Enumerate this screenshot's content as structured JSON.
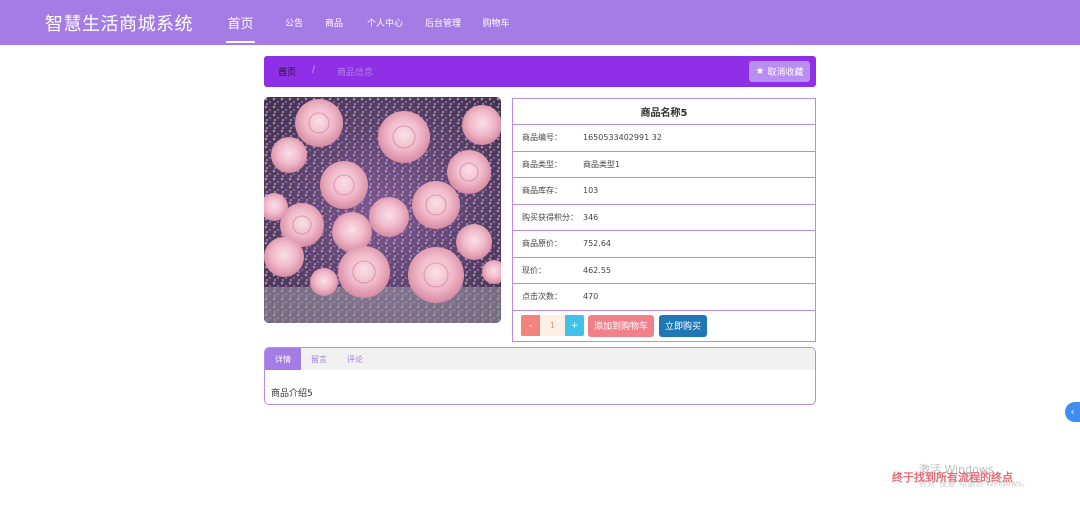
{
  "app": {
    "title": "智慧生活商城系统"
  },
  "nav": {
    "items": [
      {
        "label": "首页",
        "active": true
      },
      {
        "label": "公告",
        "active": false
      },
      {
        "label": "商品",
        "active": false
      },
      {
        "label": "个人中心",
        "active": false
      },
      {
        "label": "后台管理",
        "active": false
      },
      {
        "label": "购物车",
        "active": false
      }
    ]
  },
  "breadcrumb": {
    "home": "首页",
    "separator": "/",
    "current": "商品信息"
  },
  "favorite_button": {
    "label": "取消收藏",
    "icon": "star-icon"
  },
  "product": {
    "image_alt": "pink roses bouquet",
    "name": "商品名称5",
    "fields": [
      {
        "key": "商品编号：",
        "value": "1650533402991 32"
      },
      {
        "key": "商品类型：",
        "value": "商品类型1"
      },
      {
        "key": "商品库存：",
        "value": "103"
      },
      {
        "key": "购买获得积分：",
        "value": "346"
      },
      {
        "key": "商品原价：",
        "value": "752.64"
      },
      {
        "key": "现价：",
        "value": "462.55"
      },
      {
        "key": "点击次数：",
        "value": "470"
      }
    ]
  },
  "quantity": {
    "minus": "-",
    "value": "1",
    "plus": "+"
  },
  "actions": {
    "add_to_cart": "添加到购物车",
    "buy_now": "立即购买"
  },
  "tabs": {
    "items": [
      {
        "label": "详情",
        "active": true
      },
      {
        "label": "留言",
        "active": false
      },
      {
        "label": "评论",
        "active": false
      }
    ],
    "content": "商品介绍5"
  },
  "side_toggle": {
    "icon": "chevron-left-icon",
    "glyph": "‹"
  },
  "watermark": {
    "activate": "激活 Windows",
    "sub": "转到“设置”以激活 Windows。",
    "overlay": "终于找到所有流程的终点"
  },
  "colors": {
    "navbar": "#a57ce6",
    "breadcrumb_bar": "#8f2fe6",
    "cart_button": "#f1808b",
    "buy_button": "#1f77b3",
    "border": "#b48de8"
  }
}
